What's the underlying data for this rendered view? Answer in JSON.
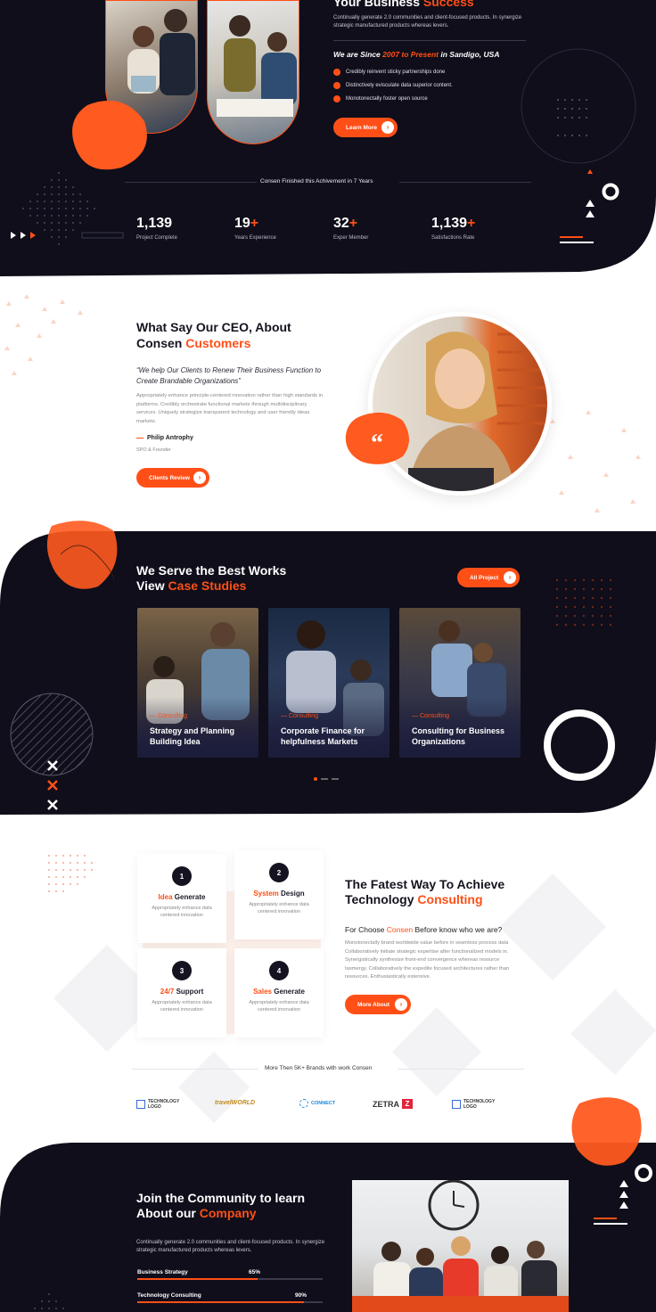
{
  "hero": {
    "title_plain": "Your Business",
    "title_accent": "Success",
    "desc": "Continually generate 2.0 communities and client-focused products. In synergize strategic manufactured products whereas levers.",
    "since_a": "We are Since",
    "since_b": "2007 to Present",
    "since_c": "in Sandigo, USA",
    "checks": [
      "Credibly reinvent sticky partnerships done",
      "Distinctively evisculate data superior content.",
      "Monotonectally foster open source"
    ],
    "button": "Learn More"
  },
  "achievement": {
    "caption": "Consen Finished this Achivement in 7 Years",
    "stats": [
      {
        "num": "1,139",
        "plus": "",
        "label": "Project Complete"
      },
      {
        "num": "19",
        "plus": "+",
        "label": "Years Experience"
      },
      {
        "num": "32",
        "plus": "+",
        "label": "Exper Member"
      },
      {
        "num": "1,139",
        "plus": "+",
        "label": "Satisfactions Rate"
      }
    ]
  },
  "ceo": {
    "title_a": "What Say Our CEO, About",
    "title_b": "Consen",
    "title_c": "Customers",
    "quote": "“We help Our Clients to Renew Their Business Function to Create Brandable Organizations”",
    "body": "Appropriately enhance principle-centered innovation rather than high standards in platforms. Credibly orchestrate functional markets through multidisciplinary services. Uniquely strategize transparent technology and user friendly ideas markets.",
    "name": "Philip Antrophy",
    "role": "SPO & Founder",
    "button": "Clients Review"
  },
  "works": {
    "title_a": "We Serve the Best Works",
    "title_b": "View",
    "title_c": "Case Studies",
    "button": "All Project",
    "cards": [
      {
        "cat": "Consulting",
        "title": "Strategy and Planning Building Idea"
      },
      {
        "cat": "Consulting",
        "title": "Corporate Finance for helpfulness Markets"
      },
      {
        "cat": "Consulting",
        "title": "Consulting for Business Organizations"
      }
    ]
  },
  "consulting": {
    "features": [
      {
        "n": "1",
        "a": "Idea",
        "b": " Generate",
        "desc": "Appropriately enhance data centered innovation"
      },
      {
        "n": "2",
        "a": "System",
        "b": " Design",
        "desc": "Appropriately enhance data centered innovation"
      },
      {
        "n": "3",
        "a": "24/7",
        "b": " Support",
        "desc": "Appropriately enhance data centered innovation"
      },
      {
        "n": "4",
        "a": "Sales",
        "b": " Generate",
        "desc": "Appropriately enhance data centered innovation"
      }
    ],
    "title_a": "The Fatest Way To Achieve",
    "title_b": "Technology",
    "title_c": "Consulting",
    "sub_a": "For Choose",
    "sub_b": "Consen",
    "sub_c": "Before know who we are?",
    "body": "Monotonectally brand worldwide value before in seamless process data Collaboratively initiate strategic expertise after functionalized models in. Synergistically synthesize front-end convergence whereas resource tasmergy. Collaboratively the expedite focused architectures rather than resources. Enthusiastically extensive.",
    "button": "More About",
    "brands_caption": "More Then 5K+ Brands with work Consen",
    "brands": [
      "TECHNOLOGY LOGO",
      "travelWORLD",
      "CONNECT",
      "ZETRA",
      "TECHNOLOGY LOGO"
    ]
  },
  "community": {
    "title_a": "Join the Community to learn",
    "title_b": "About our",
    "title_c": "Company",
    "desc": "Continually generate 2.0 communities and client-focused products. In synergize strategic manufactured products whereas levers.",
    "skills": [
      {
        "label": "Business Strategy",
        "pct": "65%",
        "value": 0.65
      },
      {
        "label": "Technology Consulting",
        "pct": "90%",
        "value": 0.9
      }
    ]
  },
  "colors": {
    "accent": "#ff4f17",
    "dark": "#0f0e1a"
  }
}
